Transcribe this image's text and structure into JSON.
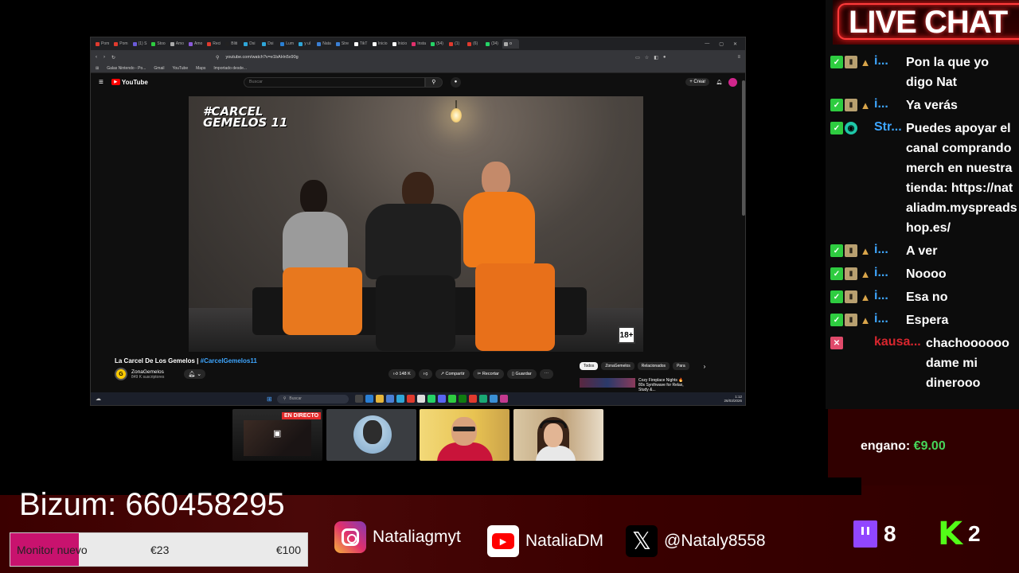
{
  "browser": {
    "tabs": [
      "Pom",
      "Pom",
      "(1) S",
      "Stoo",
      "Amo",
      "Amo",
      "Reci",
      "Bliti",
      "Dsi",
      "Dsi",
      "Lum",
      "y ul",
      "Nata",
      "Stre",
      "TikT",
      "Inicio",
      "Inicio",
      "Insta",
      "(54)",
      "(1)",
      "(6)",
      "(34)",
      "o"
    ],
    "url": "youtube.com/watch?v=e1bAHn5x90g",
    "bookmarks": [
      "Galas Nintendo - Po...",
      "Gmail",
      "YouTube",
      "Maps",
      "Importado desde..."
    ]
  },
  "youtube": {
    "logo": "YouTube",
    "search_placeholder": "Buscar",
    "create_label": "Crear",
    "video_title": "La Carcel De Los Gemelos |",
    "video_hashtag": "#CarcelGemelos11",
    "channel_initial": "G",
    "channel_name": "ZonaGemelos",
    "channel_subs": "849 K suscriptores",
    "show_logo_line1": "#CARCEL",
    "show_logo_line2": "GEMELOS 11",
    "age_rating": "18+",
    "actions": {
      "likes": "148 K",
      "share": "Compartir",
      "clip": "Recortar",
      "save": "Guardar"
    },
    "chips": [
      "Todos",
      "ZonaGemelos",
      "Relacionados",
      "Para"
    ],
    "rec_title": "Cozy Fireplace Nights 🔥 80s Synthwave for Relax, Study &..."
  },
  "taskbar": {
    "search": "Buscar",
    "time": "1:12",
    "date": "26/03/2026"
  },
  "cams": {
    "live_label": "EN DIRECTO"
  },
  "chat": {
    "title": "LIVE CHAT",
    "messages": [
      {
        "user": "i...",
        "text": "Pon la que yo digo Nat",
        "type": "sub"
      },
      {
        "user": "i...",
        "text": "Ya verás",
        "type": "sub"
      },
      {
        "user": "Str...",
        "text": "Puedes apoyar el canal comprando merch en nuestra tienda: https://nataliadm.myspreadshop.es/",
        "type": "bot"
      },
      {
        "user": "i...",
        "text": "A ver",
        "type": "sub"
      },
      {
        "user": "i...",
        "text": "Noooo",
        "type": "sub"
      },
      {
        "user": "i...",
        "text": "Esa no",
        "type": "sub"
      },
      {
        "user": "i...",
        "text": "Espera",
        "type": "sub"
      },
      {
        "user": "kausa...",
        "text": "chachoooooo dame mi dinerooo",
        "type": "red"
      }
    ]
  },
  "goal": {
    "label": "engano:",
    "amount": "€9.00"
  },
  "bizum": "Bizum: 660458295",
  "progress": {
    "label": "Monitor nuevo",
    "current": "€23",
    "max": "€100",
    "fraction": 0.23
  },
  "socials": {
    "instagram": "Nataliagmyt",
    "youtube": "NataliaDM",
    "x": "@Nataly8558"
  },
  "counts": {
    "twitch": "8",
    "kick": "2"
  },
  "colors": {
    "accent_red": "#ff3b3b",
    "progress_fill": "#c8126e",
    "twitch": "#9146ff",
    "kick": "#53fc18"
  }
}
